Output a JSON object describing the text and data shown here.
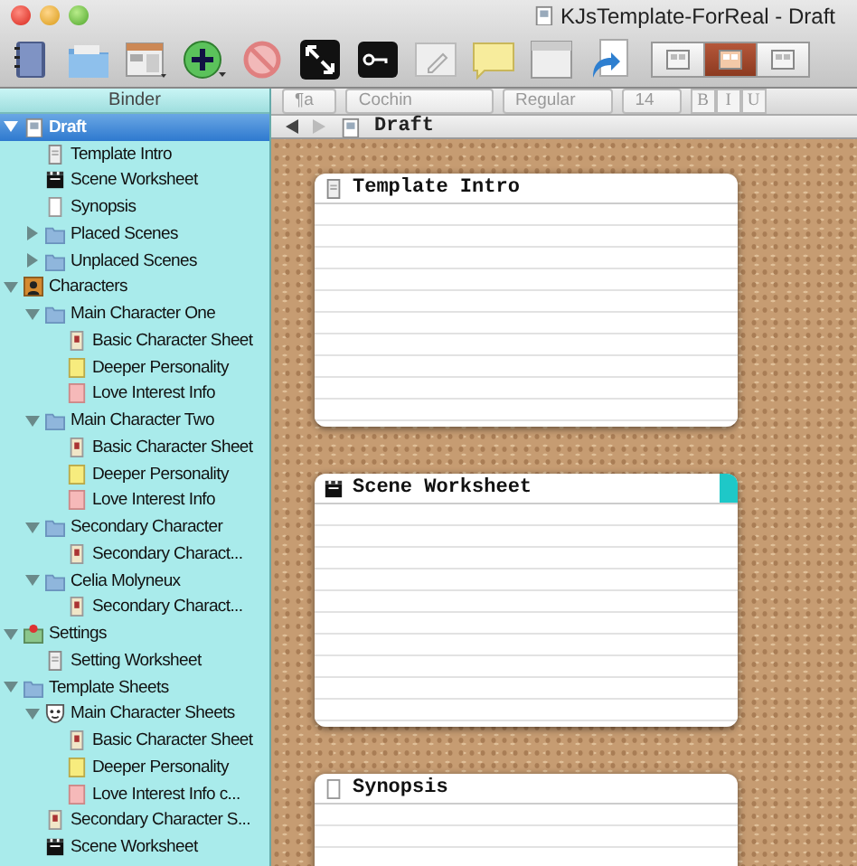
{
  "window": {
    "title": "KJsTemplate-ForReal - Draft"
  },
  "view_modes": [
    {
      "selected": false
    },
    {
      "selected": true
    },
    {
      "selected": false
    }
  ],
  "binder": {
    "title": "Binder",
    "items": [
      {
        "label": "Draft",
        "kind": "draft",
        "expanded": true,
        "selected": true,
        "children": [
          {
            "label": "Template Intro",
            "kind": "document",
            "selected": false
          },
          {
            "label": "Scene Worksheet",
            "kind": "scene",
            "selected": false
          },
          {
            "label": "Synopsis",
            "kind": "blank",
            "selected": false
          },
          {
            "label": "Placed Scenes",
            "kind": "folder",
            "expanded": false,
            "selected": false
          },
          {
            "label": "Unplaced Scenes",
            "kind": "folder",
            "expanded": false,
            "selected": false
          }
        ]
      },
      {
        "label": "Characters",
        "kind": "characters",
        "expanded": true,
        "selected": false,
        "children": [
          {
            "label": "Main Character One",
            "kind": "folder",
            "expanded": true,
            "selected": false,
            "children": [
              {
                "label": "Basic Character Sheet",
                "kind": "sheet",
                "selected": false
              },
              {
                "label": "Deeper Personality",
                "kind": "yellow-note",
                "selected": false
              },
              {
                "label": "Love Interest Info",
                "kind": "pink-note",
                "selected": false
              }
            ]
          },
          {
            "label": "Main Character Two",
            "kind": "folder",
            "expanded": true,
            "selected": false,
            "children": [
              {
                "label": "Basic Character Sheet",
                "kind": "sheet",
                "selected": false
              },
              {
                "label": "Deeper Personality",
                "kind": "yellow-note",
                "selected": false
              },
              {
                "label": "Love Interest Info",
                "kind": "pink-note",
                "selected": false
              }
            ]
          },
          {
            "label": "Secondary Character",
            "kind": "folder",
            "expanded": true,
            "selected": false,
            "children": [
              {
                "label": "Secondary Charact...",
                "kind": "sheet",
                "selected": false
              }
            ]
          },
          {
            "label": "Celia Molyneux",
            "kind": "folder",
            "expanded": true,
            "selected": false,
            "children": [
              {
                "label": "Secondary Charact...",
                "kind": "sheet",
                "selected": false
              }
            ]
          }
        ]
      },
      {
        "label": "Settings",
        "kind": "settings",
        "expanded": true,
        "selected": false,
        "children": [
          {
            "label": "Setting Worksheet",
            "kind": "document",
            "selected": false
          }
        ]
      },
      {
        "label": "Template Sheets",
        "kind": "folder",
        "expanded": true,
        "selected": false,
        "children": [
          {
            "label": "Main Character Sheets",
            "kind": "mask",
            "expanded": true,
            "selected": false,
            "children": [
              {
                "label": "Basic Character Sheet",
                "kind": "sheet",
                "selected": false
              },
              {
                "label": "Deeper Personality",
                "kind": "yellow-note",
                "selected": false
              },
              {
                "label": "Love Interest Info c...",
                "kind": "pink-note",
                "selected": false
              }
            ]
          },
          {
            "label": "Secondary Character S...",
            "kind": "sheet",
            "selected": false
          },
          {
            "label": "Scene Worksheet",
            "kind": "scene",
            "selected": false
          }
        ]
      }
    ]
  },
  "format_bar": {
    "style": "¶a",
    "font": "Cochin",
    "weight": "Regular",
    "size": "14",
    "bold": "B",
    "italic": "I",
    "underline": "U"
  },
  "header": {
    "title": "Draft"
  },
  "cards": [
    {
      "title": "Template Intro",
      "kind": "document"
    },
    {
      "title": "Scene Worksheet",
      "kind": "scene",
      "color": "#1ec8c8"
    },
    {
      "title": "Synopsis",
      "kind": "blank"
    }
  ]
}
